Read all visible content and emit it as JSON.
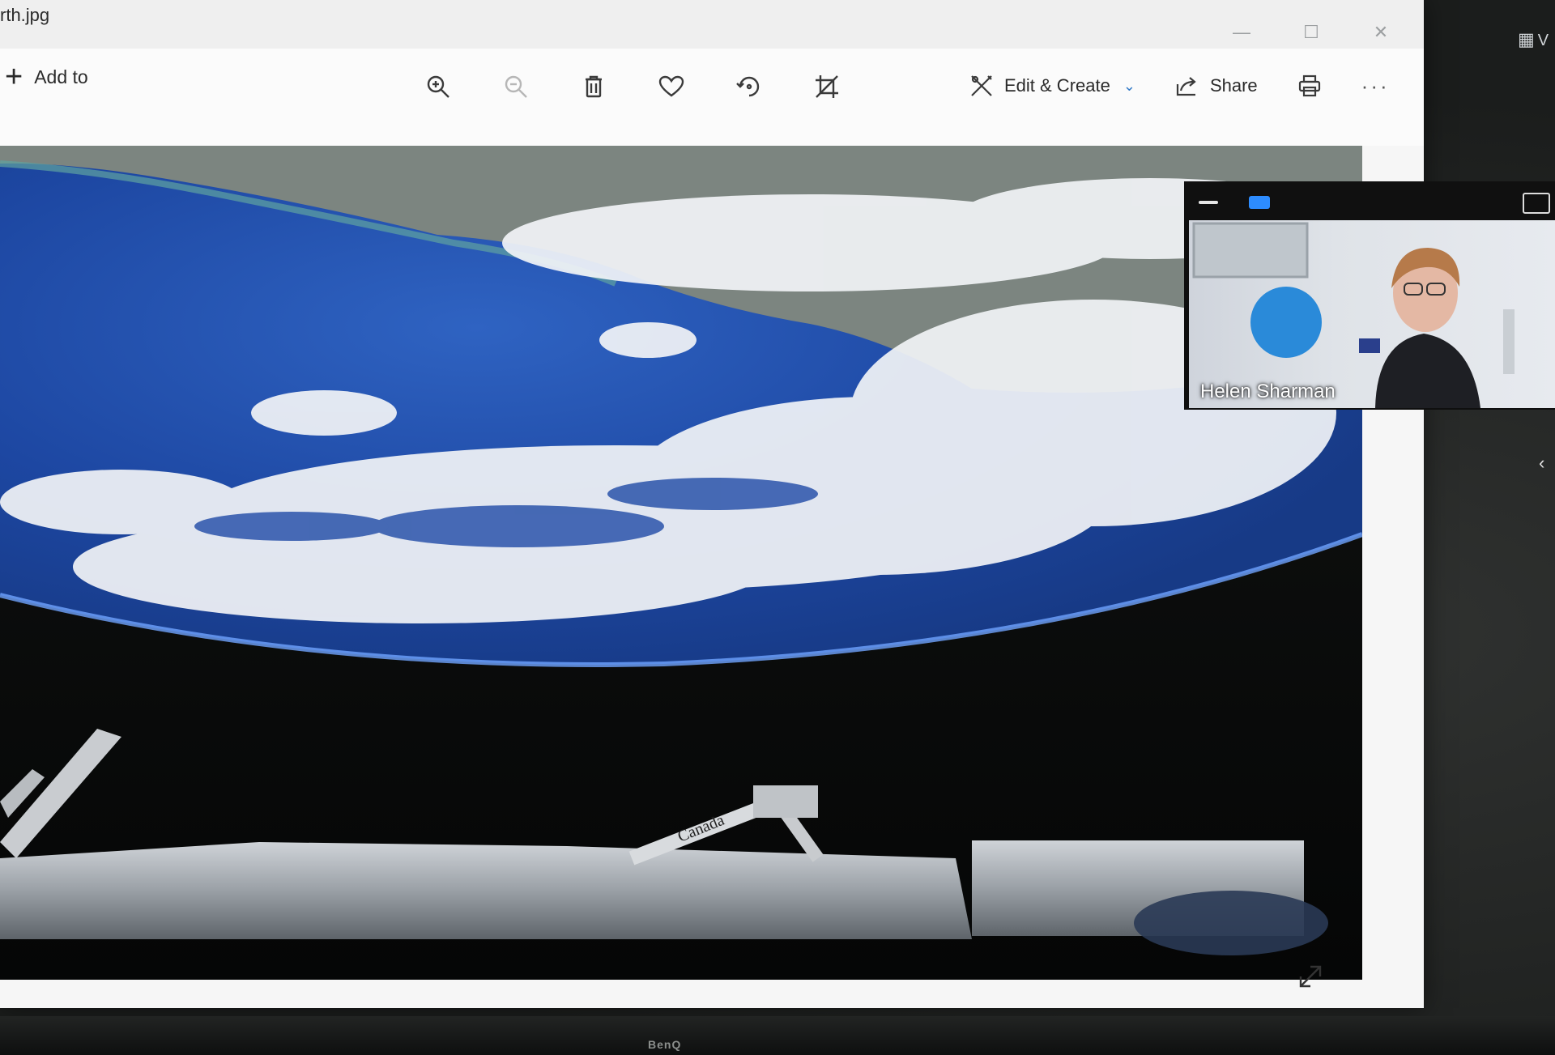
{
  "window": {
    "file_title": "rth.jpg",
    "controls": [
      "—",
      "☐",
      "✕"
    ]
  },
  "toolbar": {
    "add_to_label": "Add to",
    "tools": [
      {
        "name": "zoom-in-icon",
        "enabled": true
      },
      {
        "name": "zoom-out-icon",
        "enabled": false
      },
      {
        "name": "delete-icon",
        "enabled": true
      },
      {
        "name": "favorite-icon",
        "enabled": true
      },
      {
        "name": "rotate-icon",
        "enabled": true
      },
      {
        "name": "crop-icon",
        "enabled": true
      }
    ],
    "edit_create_label": "Edit & Create",
    "share_label": "Share",
    "more_label": "···"
  },
  "photo": {
    "arm_label": "Canada"
  },
  "video_call": {
    "speaker_name": "Helen Sharman",
    "accent_color": "#2d8cff"
  },
  "monitor": {
    "brand": "BenQ"
  },
  "edge": {
    "top_right_partial": "V",
    "side_chevron": "‹"
  }
}
